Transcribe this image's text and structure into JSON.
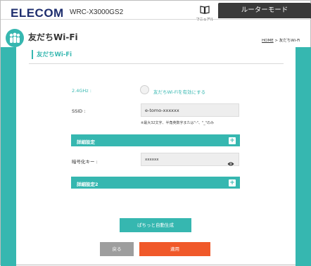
{
  "header": {
    "brand": "ELECOM",
    "model": "WRC-X3000GS2",
    "manual_label": "マニュアル",
    "mode_label": "ルーターモード"
  },
  "page": {
    "title": "友だちWi-Fi",
    "breadcrumb_home": "HOME",
    "breadcrumb_current": " > 友だちWi-Fi"
  },
  "section": {
    "title": "友だちWi-Fi"
  },
  "form": {
    "band_label": "2.4GHz :",
    "enable_label": "友だちWi-Fiを有効にする",
    "enable_checked": false,
    "ssid_label": "SSID :",
    "ssid_value": "e-tomo-xxxxxx",
    "ssid_note": "※最大32文字、半角英数字または\"-\"、\"_\"のみ",
    "advanced_label": "詳細設定",
    "key_label": "暗号化キー :",
    "key_value": "xxxxxx",
    "advanced2_label": "詳細設定2"
  },
  "buttons": {
    "generate": "ぱちっと自動生成",
    "back": "戻る",
    "apply": "適用"
  },
  "colors": {
    "accent": "#36b7b0",
    "apply": "#f0592a",
    "back": "#9e9e9e",
    "mode_tab": "#3a3a3a",
    "brand": "#1e2e6e"
  },
  "icons": [
    "book-icon",
    "people-icon",
    "eye-icon",
    "plus-icon"
  ]
}
